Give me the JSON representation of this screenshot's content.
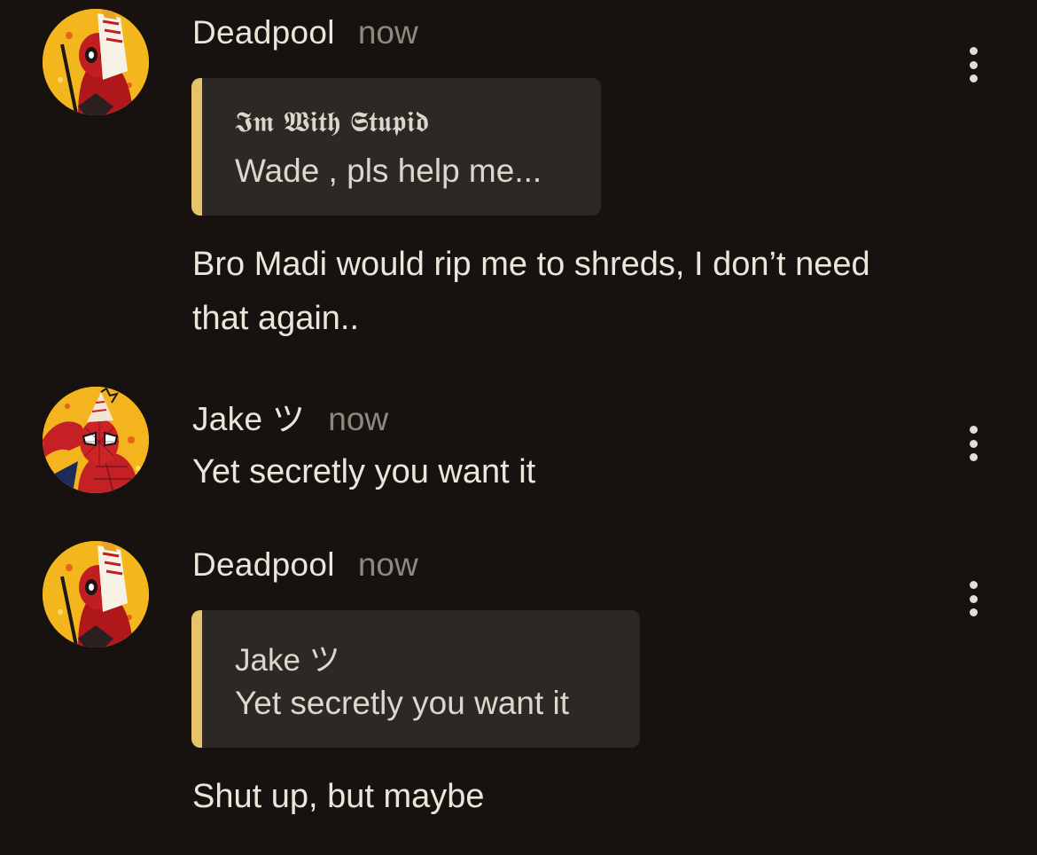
{
  "colors": {
    "background": "#17120f",
    "text": "#ece5da",
    "muted": "#8f887d",
    "quote_bg": "#2d2825",
    "quote_accent": "#e7c46a"
  },
  "messages": [
    {
      "author": "Deadpool",
      "time": "now",
      "avatar_icon": "deadpool-avatar-icon",
      "more_icon": "more-vertical-icon",
      "quote": {
        "author": "𝕴𝖒 𝖂𝖎𝖙𝖍 𝕾𝖙𝖚𝖕𝖎𝖉",
        "text": "Wade , pls help me..."
      },
      "text": "Bro Madi would rip me to shreds, I don’t need that again.."
    },
    {
      "author": "Jake ツ",
      "time": "now",
      "avatar_icon": "spiderman-avatar-icon",
      "more_icon": "more-vertical-icon",
      "text": "Yet secretly you want it"
    },
    {
      "author": "Deadpool",
      "time": "now",
      "avatar_icon": "deadpool-avatar-icon",
      "more_icon": "more-vertical-icon",
      "quote": {
        "author": "Jake ツ",
        "text": "Yet secretly you want it"
      },
      "text": "Shut up, but maybe"
    }
  ]
}
